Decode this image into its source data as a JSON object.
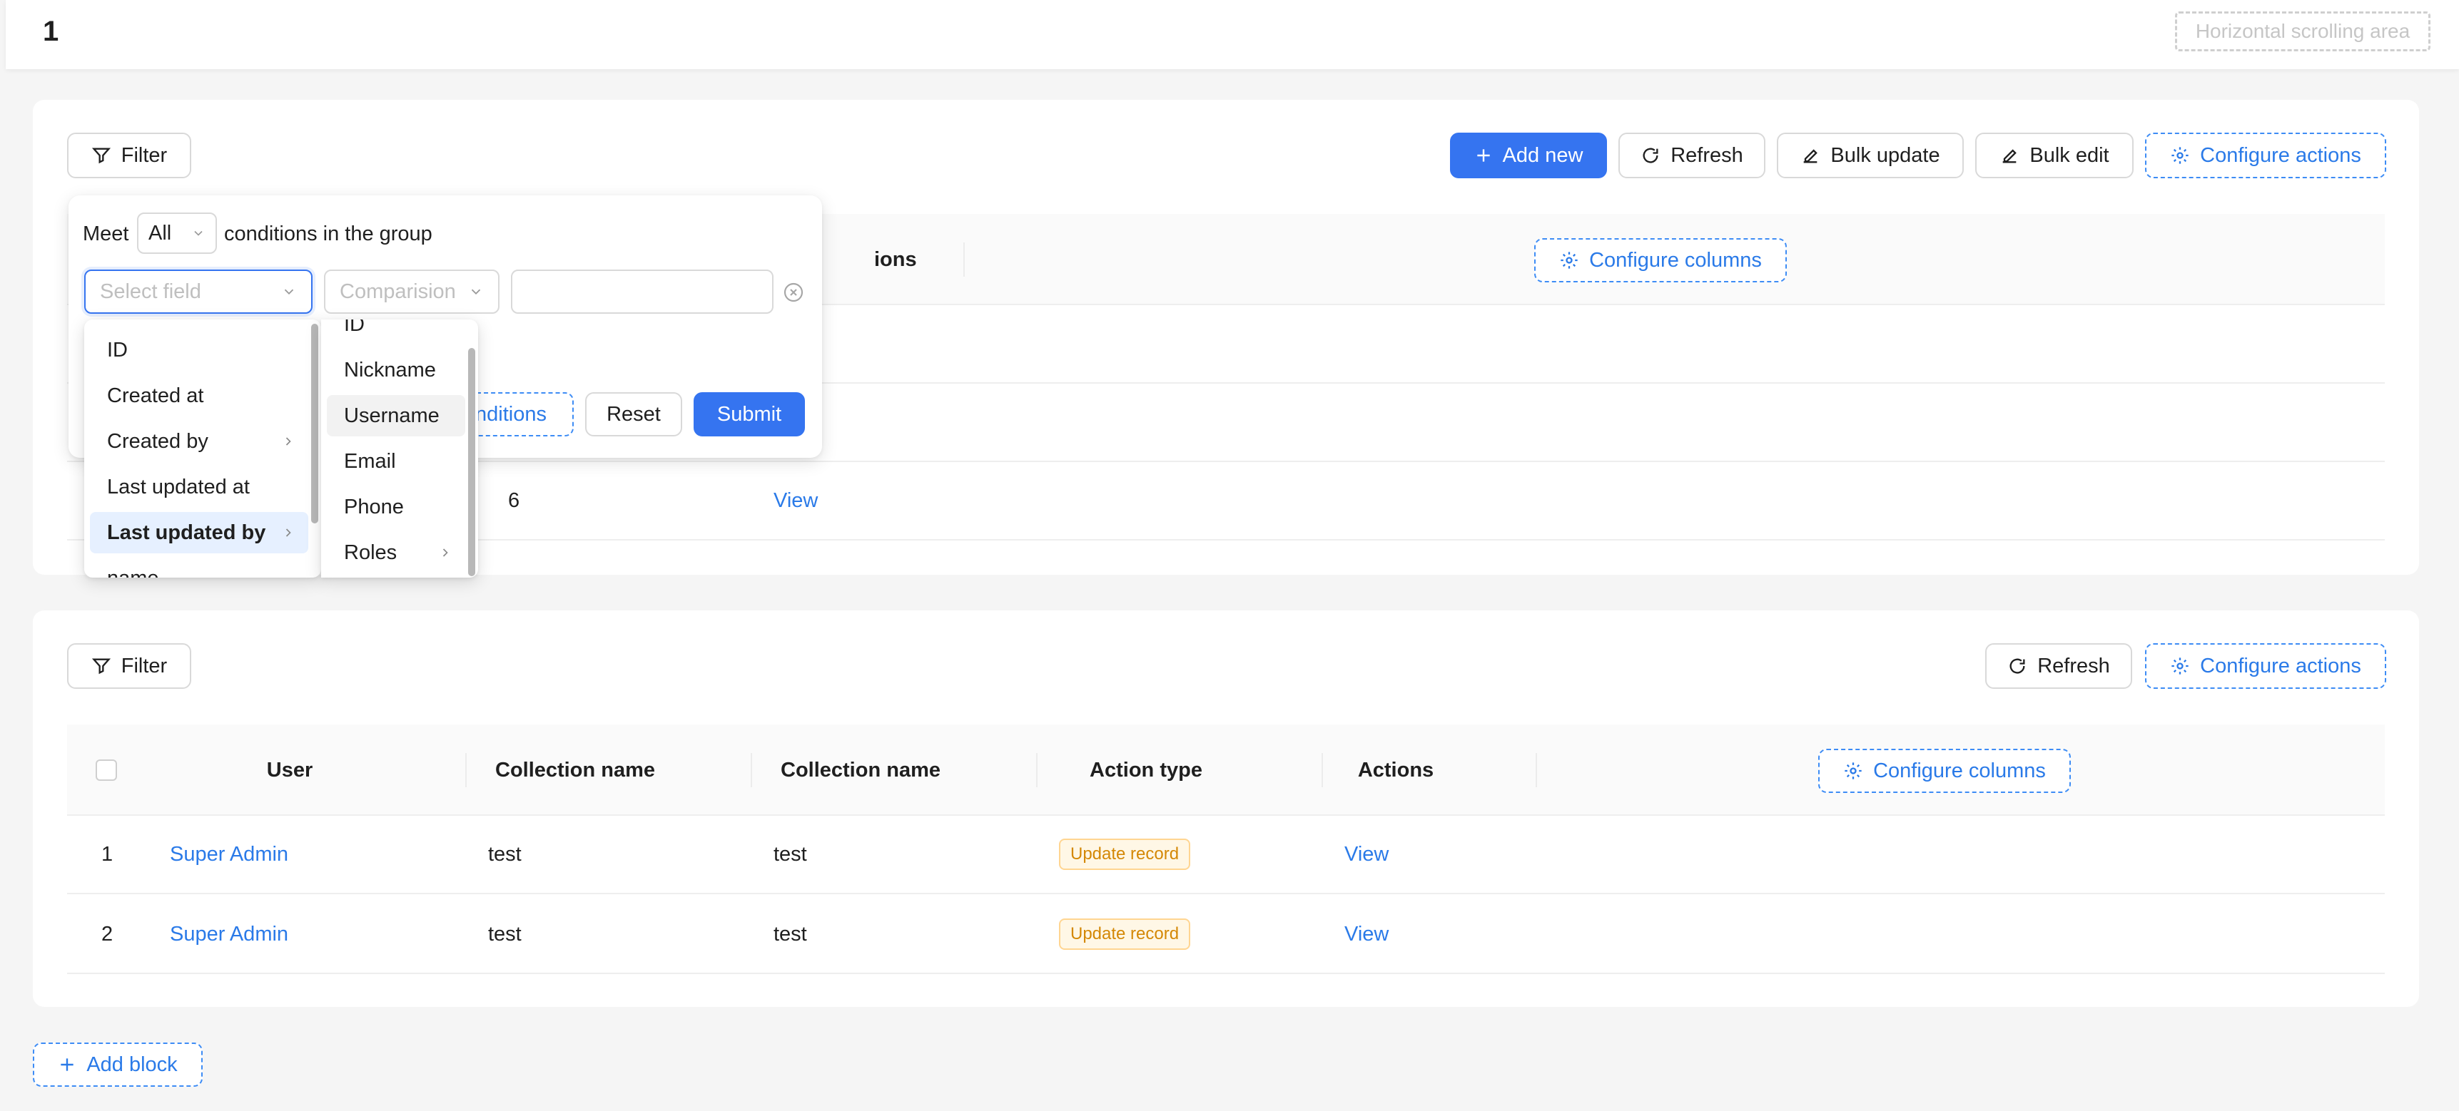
{
  "page": {
    "title": "1",
    "hscroll_label": "Horizontal scrolling area"
  },
  "block1": {
    "filter_label": "Filter",
    "actions": {
      "add_new": "Add new",
      "refresh": "Refresh",
      "bulk_update": "Bulk update",
      "bulk_edit": "Bulk edit",
      "configure_actions": "Configure actions"
    },
    "table": {
      "partial_header": "ions",
      "configure_columns": "Configure columns",
      "partial_cell": "6",
      "row_link": "View"
    }
  },
  "filter_popover": {
    "meet": "Meet",
    "all": "All",
    "conditions_text": "conditions in the group",
    "field_placeholder": "Select field",
    "comparison_placeholder": "Comparision",
    "value_placeholder": "",
    "add_conditions_partial": "nditions",
    "reset": "Reset",
    "submit": "Submit",
    "field_options": [
      "ID",
      "Created at",
      "Created by",
      "Last updated at",
      "Last updated by",
      "name"
    ],
    "sub_options": [
      "ID",
      "Nickname",
      "Username",
      "Email",
      "Phone",
      "Roles"
    ]
  },
  "block2": {
    "filter_label": "Filter",
    "actions": {
      "refresh": "Refresh",
      "configure_actions": "Configure actions"
    },
    "columns": [
      "User",
      "Collection name",
      "Collection name",
      "Action type",
      "Actions"
    ],
    "configure_columns": "Configure columns",
    "rows": [
      {
        "index": "1",
        "user": "Super Admin",
        "collection1": "test",
        "collection2": "test",
        "action_type": "Update record",
        "action": "View"
      },
      {
        "index": "2",
        "user": "Super Admin",
        "collection1": "test",
        "collection2": "test",
        "action_type": "Update record",
        "action": "View"
      }
    ]
  },
  "add_block": "Add block",
  "colors": {
    "primary": "#3574f0",
    "link": "#2a7ae8",
    "tag_bg": "#fff7e6",
    "tag_text": "#d48806"
  }
}
